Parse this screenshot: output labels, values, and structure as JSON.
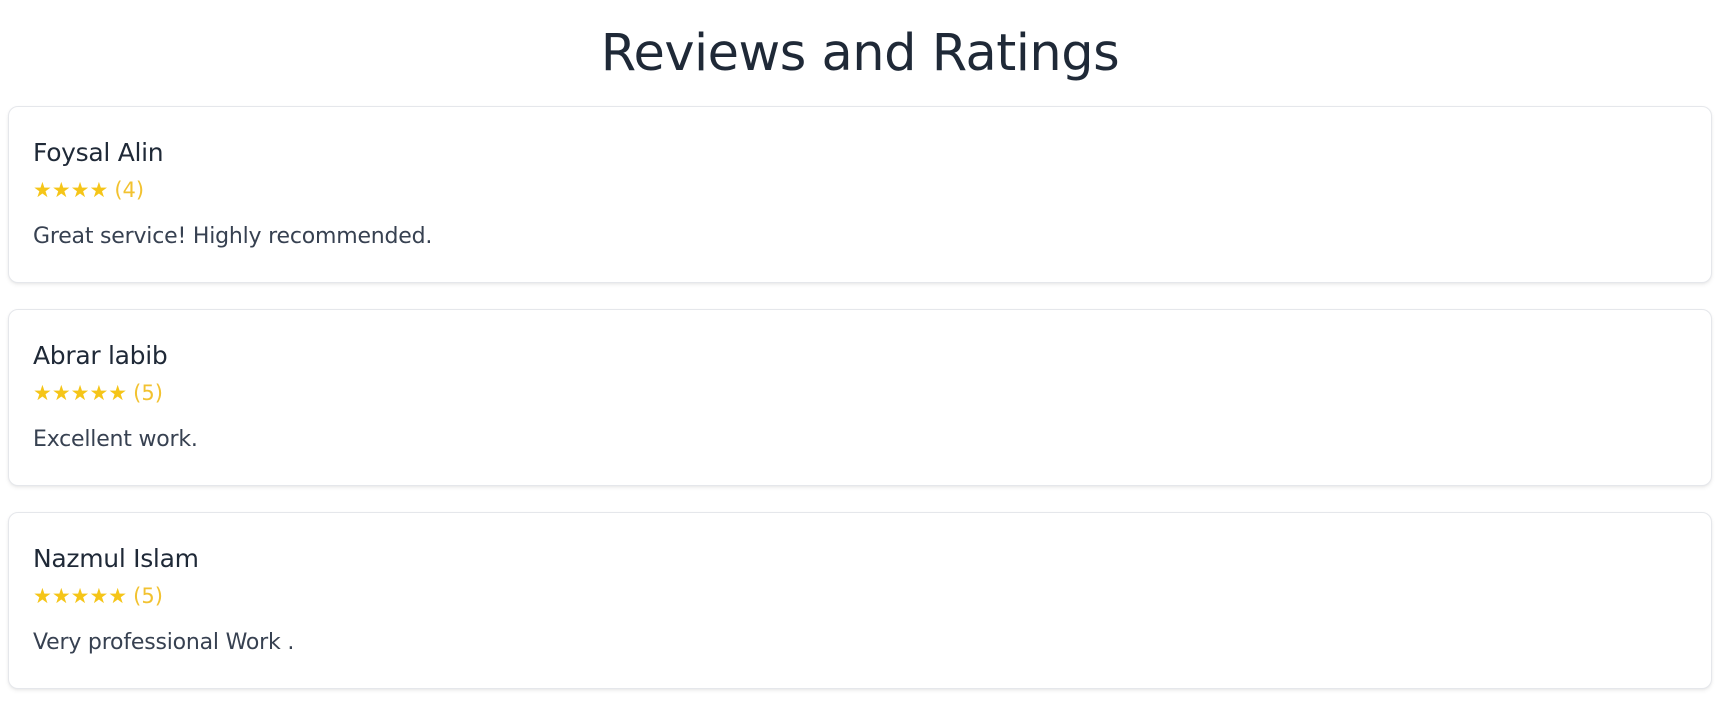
{
  "page": {
    "title": "Reviews and Ratings"
  },
  "colors": {
    "star": "#f5c518",
    "title_text": "#1f2937",
    "body_text": "#374151",
    "card_border": "#e5e7eb"
  },
  "reviews": [
    {
      "name": "Foysal Alin",
      "stars": "★★★★",
      "rating_label": "(4)",
      "rating": 4,
      "comment": "Great service! Highly recommended."
    },
    {
      "name": "Abrar labib",
      "stars": "★★★★★",
      "rating_label": "(5)",
      "rating": 5,
      "comment": "Excellent work."
    },
    {
      "name": "Nazmul Islam",
      "stars": "★★★★★",
      "rating_label": "(5)",
      "rating": 5,
      "comment": "Very professional Work ."
    }
  ]
}
